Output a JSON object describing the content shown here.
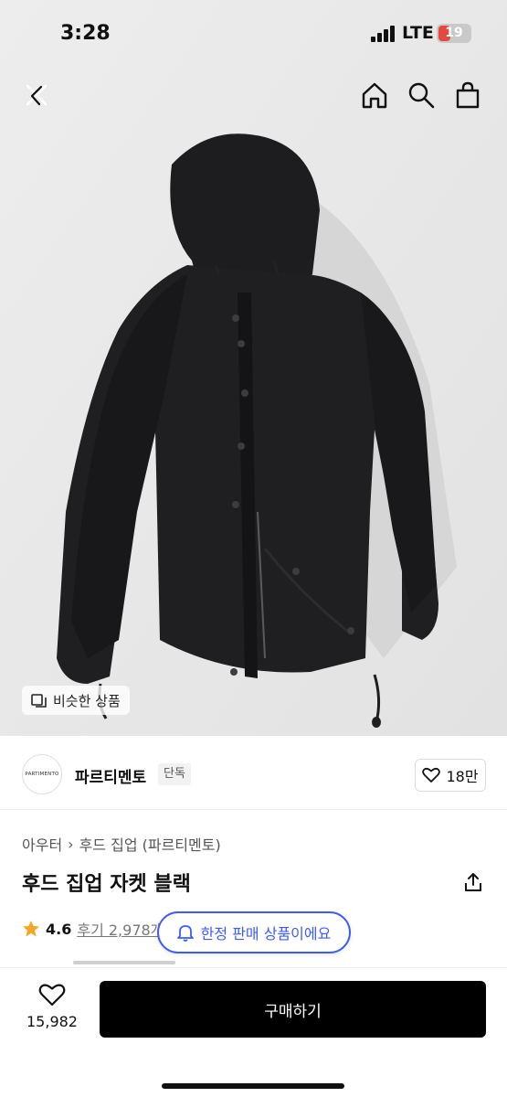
{
  "status_bar": {
    "time": "3:28",
    "network": "LTE",
    "battery": "19"
  },
  "nav": {
    "back_icon": "close-back-icon",
    "home_icon": "home-icon",
    "search_icon": "search-icon",
    "cart_icon": "shopping-bag-icon"
  },
  "hero": {
    "similar_label": "비슷한 상품"
  },
  "brand": {
    "logo_text": "PARTIMENTO",
    "name": "파르티멘토",
    "badge": "단독",
    "likes": "18만"
  },
  "product": {
    "category": "아우터",
    "subcategory": "후드 집업 (파르티멘토)",
    "title": "후드 집업 자켓 블랙",
    "rating": "4.6",
    "reviews": "후기 2,978개"
  },
  "toast": {
    "text": "한정 판매 상품이에요"
  },
  "bottom": {
    "wish_count": "15,982",
    "buy_label": "구매하기"
  },
  "colors": {
    "accent": "#3b5bff",
    "star": "#f5a623",
    "battery_low": "#e5483f",
    "buy_button": "#000000"
  }
}
